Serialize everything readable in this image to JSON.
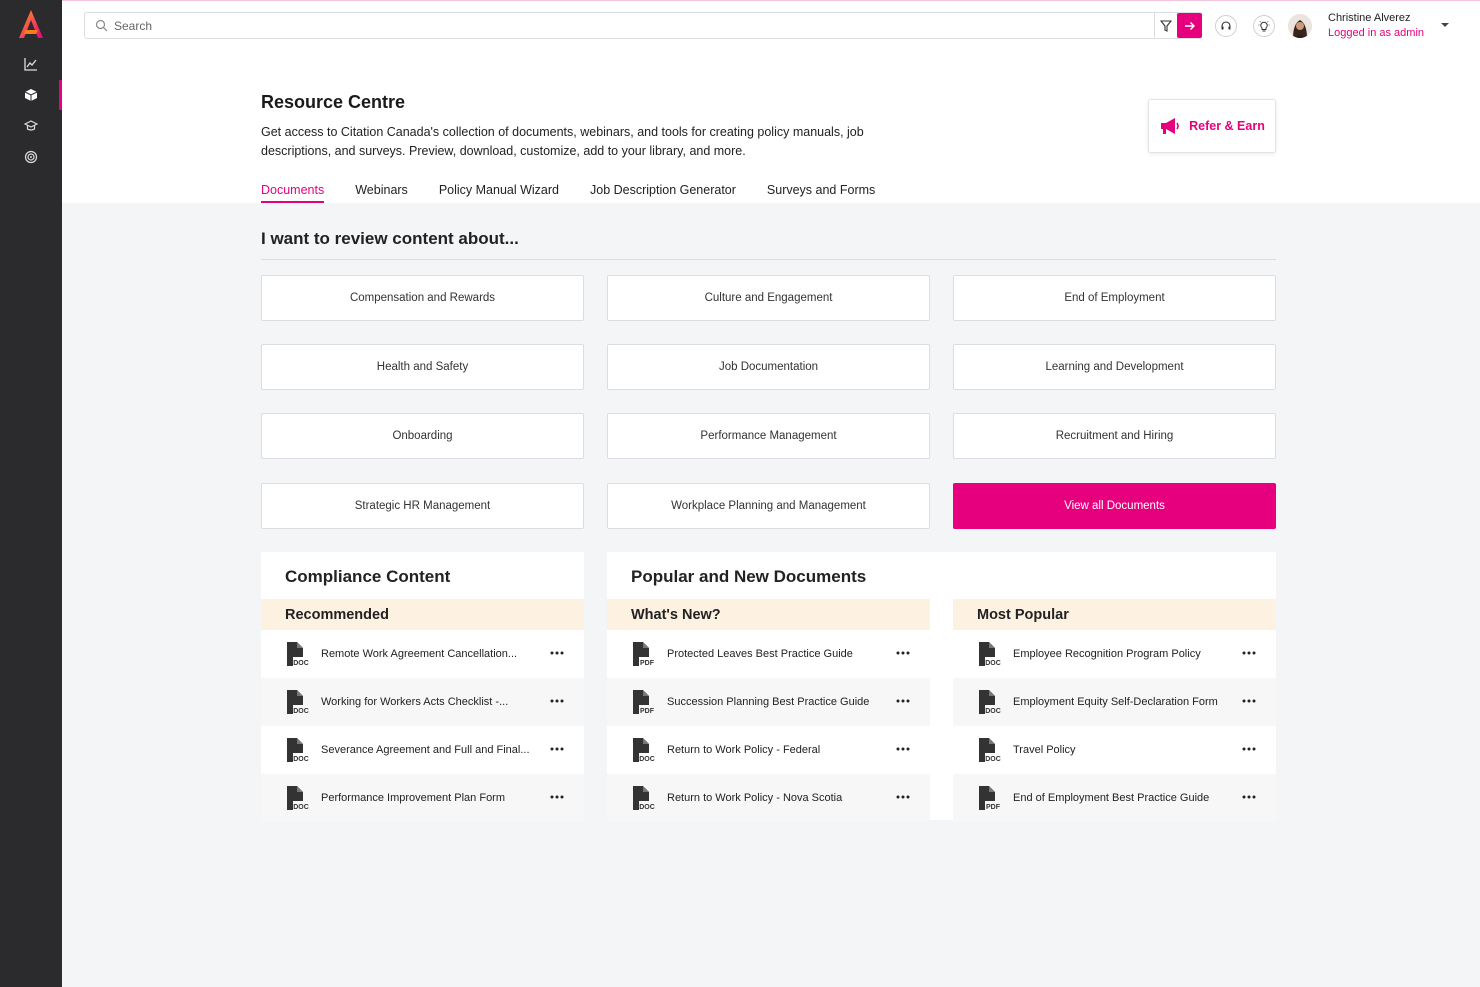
{
  "topbar": {
    "search_placeholder": "Search",
    "user_name": "Christine Alverez",
    "user_role": "Logged in as admin"
  },
  "colors": {
    "accent": "#e6007e",
    "sidebar": "#2b2b2d",
    "highlight": "#fdf1e1"
  },
  "header": {
    "title": "Resource Centre",
    "description": "Get access to Citation Canada's collection of documents, webinars, and tools for creating policy manuals, job descriptions, and surveys. Preview, download, customize, add to your library, and more.",
    "refer_label": "Refer & Earn",
    "tabs": [
      "Documents",
      "Webinars",
      "Policy Manual Wizard",
      "Job Description Generator",
      "Surveys and Forms"
    ]
  },
  "review": {
    "title": "I want to review content about...",
    "categories": [
      "Compensation and Rewards",
      "Culture and Engagement",
      "End of Employment",
      "Health and Safety",
      "Job Documentation",
      "Learning and Development",
      "Onboarding",
      "Performance Management",
      "Recruitment and Hiring",
      "Strategic HR Management",
      "Workplace Planning and Management"
    ],
    "view_all_label": "View all Documents"
  },
  "compliance": {
    "title": "Compliance Content",
    "subhead": "Recommended",
    "docs": [
      {
        "label": "Remote Work Agreement Cancellation...",
        "type": "DOC"
      },
      {
        "label": "Working for Workers Acts Checklist -...",
        "type": "DOC"
      },
      {
        "label": "Severance Agreement and Full and Final...",
        "type": "DOC"
      },
      {
        "label": "Performance Improvement Plan Form",
        "type": "DOC"
      }
    ]
  },
  "popular": {
    "title": "Popular and New Documents",
    "whats_new": {
      "subhead": "What's New?",
      "docs": [
        {
          "label": "Protected Leaves Best Practice Guide",
          "type": "PDF"
        },
        {
          "label": "Succession Planning Best Practice Guide",
          "type": "PDF"
        },
        {
          "label": "Return to Work Policy - Federal",
          "type": "DOC"
        },
        {
          "label": "Return to Work Policy - Nova Scotia",
          "type": "DOC"
        }
      ]
    },
    "most_popular": {
      "subhead": "Most Popular",
      "docs": [
        {
          "label": "Employee Recognition Program Policy",
          "type": "DOC"
        },
        {
          "label": "Employment Equity Self-Declaration Form",
          "type": "DOC"
        },
        {
          "label": "Travel Policy",
          "type": "DOC"
        },
        {
          "label": "End of Employment Best Practice Guide",
          "type": "PDF"
        }
      ]
    }
  }
}
